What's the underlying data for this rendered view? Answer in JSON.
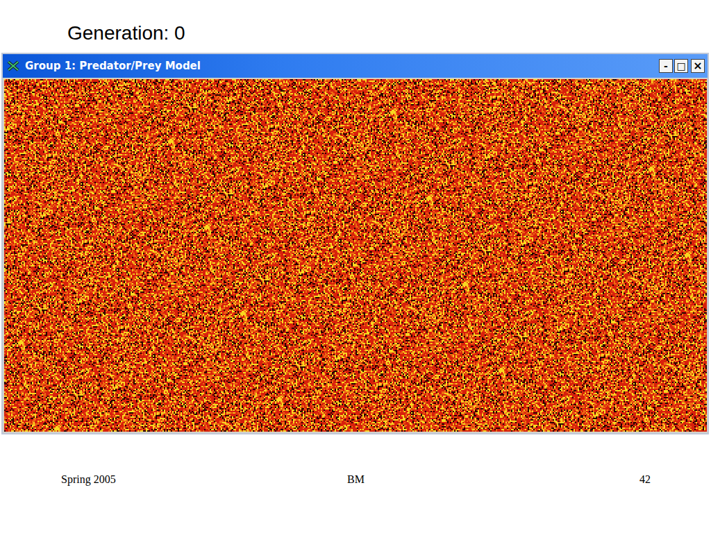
{
  "slide": {
    "title": "Generation: 0"
  },
  "window": {
    "title": "Group 1: Predator/Prey Model",
    "buttons": [
      {
        "glyph": "-",
        "name": "minimize"
      },
      {
        "glyph": "□",
        "name": "maximize"
      },
      {
        "glyph": "×",
        "name": "close"
      }
    ]
  },
  "grid": {
    "cell_states": [
      {
        "kind": "red",
        "color": "#d8200c"
      },
      {
        "kind": "orange",
        "color": "#ee6a12"
      },
      {
        "kind": "yellow",
        "color": "#f8d820"
      },
      {
        "kind": "dark",
        "color": "#2a0400"
      }
    ]
  },
  "footer": {
    "left": "Spring 2005",
    "center": "BM",
    "right": "42"
  }
}
